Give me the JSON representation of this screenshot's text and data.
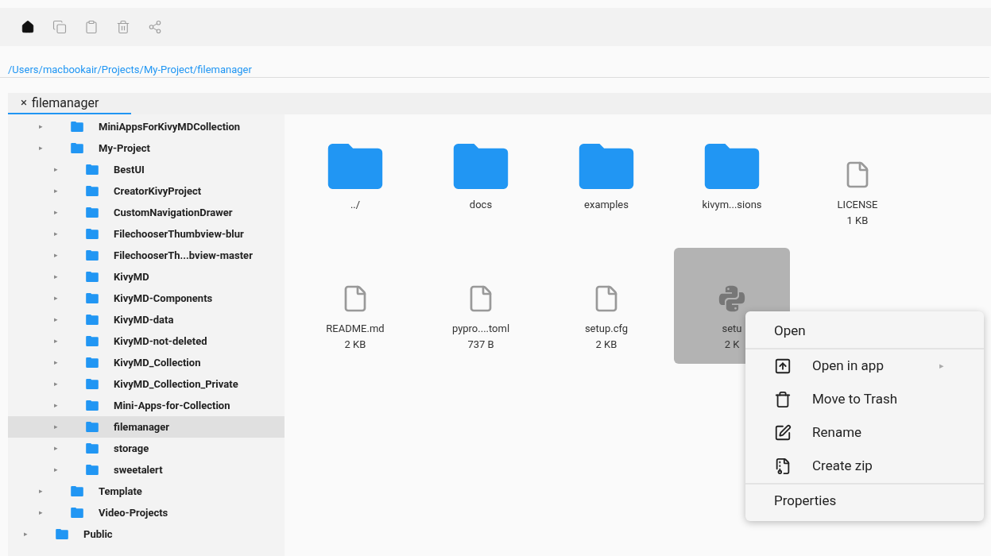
{
  "toolbar": {
    "buttons": [
      {
        "kind": "home",
        "disabled": false
      },
      {
        "kind": "copy",
        "disabled": true
      },
      {
        "kind": "paste",
        "disabled": true
      },
      {
        "kind": "delete",
        "disabled": true
      },
      {
        "kind": "share",
        "disabled": true
      }
    ]
  },
  "path": "/Users/macbookair/Projects/My-Project/filemanager",
  "tabs": [
    {
      "label": "filemanager",
      "close": "×",
      "selected": true
    }
  ],
  "tree": [
    {
      "children": [
        {
          "name": "MiniAppsForKivyMDCollection",
          "arrow": "▸",
          "selected": false
        },
        {
          "name": "My-Project",
          "arrow": "▸",
          "selected": false,
          "children": [
            {
              "name": "BestUI",
              "arrow": "▸",
              "selected": false
            },
            {
              "name": "CreatorKivyProject",
              "arrow": "▸",
              "selected": false
            },
            {
              "name": "CustomNavigationDrawer",
              "arrow": "▸",
              "selected": false
            },
            {
              "name": "FilechooserThumbview-blur",
              "arrow": "▸",
              "selected": false
            },
            {
              "name": "FilechooserTh...bview-master",
              "arrow": "▸",
              "selected": false
            },
            {
              "name": "KivyMD",
              "arrow": "▸",
              "selected": false
            },
            {
              "name": "KivyMD-Components",
              "arrow": "▸",
              "selected": false
            },
            {
              "name": "KivyMD-data",
              "arrow": "▸",
              "selected": false
            },
            {
              "name": "KivyMD-not-deleted",
              "arrow": "▸",
              "selected": false
            },
            {
              "name": "KivyMD_Collection",
              "arrow": "▸",
              "selected": false
            },
            {
              "name": "KivyMD_Collection_Private",
              "arrow": "▸",
              "selected": false
            },
            {
              "name": "Mini-Apps-for-Collection",
              "arrow": "▸",
              "selected": false
            },
            {
              "name": "filemanager",
              "arrow": "▸",
              "selected": true
            },
            {
              "name": "storage",
              "arrow": "▸",
              "selected": false
            },
            {
              "name": "sweetalert",
              "arrow": "▸",
              "selected": false
            }
          ]
        },
        {
          "name": "Template",
          "arrow": "▸",
          "selected": false
        },
        {
          "name": "Video-Projects",
          "arrow": "▸",
          "selected": false
        }
      ]
    },
    {
      "name": "Public",
      "arrow": "▸",
      "selected": false
    }
  ],
  "files": [
    {
      "name": "../",
      "kind": "folder",
      "selected": false
    },
    {
      "name": "docs",
      "kind": "folder",
      "selected": false
    },
    {
      "name": "examples",
      "kind": "folder",
      "selected": false
    },
    {
      "name": "kivym...sions",
      "kind": "folder",
      "selected": false
    },
    {
      "name": "LICENSE",
      "size": "1 KB",
      "kind": "file",
      "selected": false
    },
    {
      "name": "README.md",
      "size": "2 KB",
      "kind": "file",
      "selected": false
    },
    {
      "name": "pypro....toml",
      "size": "737 B",
      "kind": "file",
      "selected": false
    },
    {
      "name": "setup.cfg",
      "size": "2 KB",
      "kind": "file",
      "selected": false
    },
    {
      "name": "setu",
      "size": "2 K",
      "kind": "python",
      "selected": true
    }
  ],
  "context_menu": {
    "sections": [
      [
        {
          "label": "Open"
        }
      ],
      [
        {
          "label": "Open in app",
          "kind": "open-app",
          "submenu": "▸"
        },
        {
          "label": "Move to Trash",
          "kind": "trash"
        },
        {
          "label": "Rename",
          "kind": "rename"
        },
        {
          "label": "Create zip",
          "kind": "zip"
        }
      ],
      [
        {
          "label": "Properties"
        }
      ]
    ]
  }
}
